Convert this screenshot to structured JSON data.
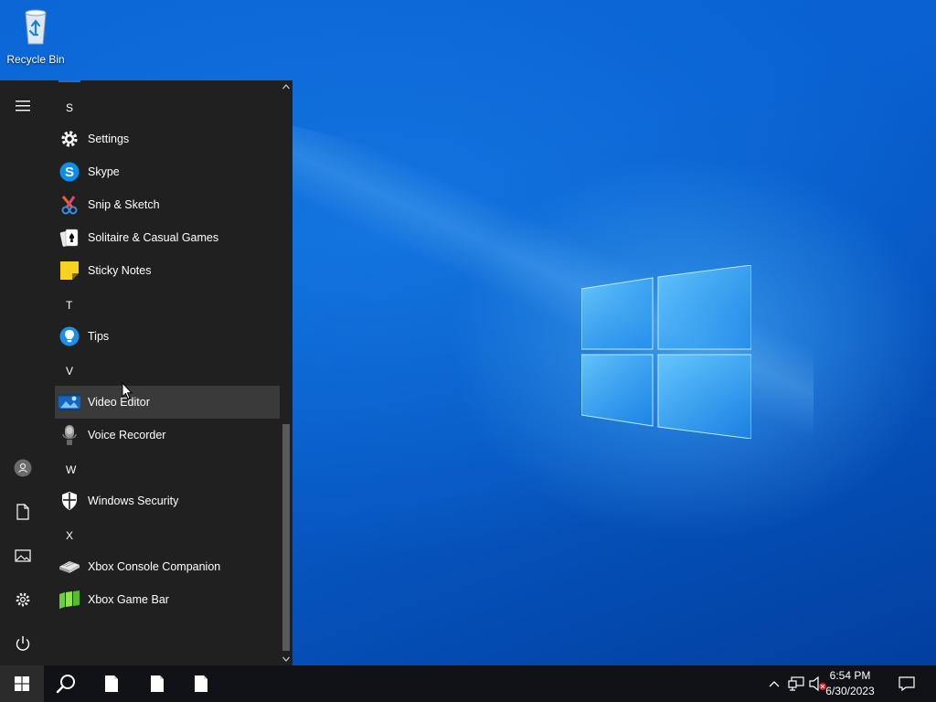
{
  "desktop": {
    "icons": [
      {
        "label": "Recycle Bin",
        "icon": "recycle-bin-icon"
      }
    ]
  },
  "start_menu": {
    "rail": {
      "items": [
        {
          "name": "hamburger-menu-icon",
          "label": ""
        },
        {
          "name": "user-account-icon",
          "label": ""
        },
        {
          "name": "documents-icon",
          "label": ""
        },
        {
          "name": "pictures-icon",
          "label": ""
        },
        {
          "name": "settings-icon",
          "label": ""
        },
        {
          "name": "power-icon",
          "label": ""
        }
      ]
    },
    "groups": [
      {
        "letter": "S",
        "apps": [
          {
            "label": "Settings",
            "icon": "gear-icon"
          },
          {
            "label": "Skype",
            "icon": "skype-icon"
          },
          {
            "label": "Snip & Sketch",
            "icon": "snip-sketch-icon"
          },
          {
            "label": "Solitaire & Casual Games",
            "icon": "solitaire-icon"
          },
          {
            "label": "Sticky Notes",
            "icon": "sticky-notes-icon"
          }
        ]
      },
      {
        "letter": "T",
        "apps": [
          {
            "label": "Tips",
            "icon": "lightbulb-icon"
          }
        ]
      },
      {
        "letter": "V",
        "apps": [
          {
            "label": "Video Editor",
            "icon": "video-editor-icon",
            "hovered": true
          },
          {
            "label": "Voice Recorder",
            "icon": "microphone-icon"
          }
        ]
      },
      {
        "letter": "W",
        "apps": [
          {
            "label": "Windows Security",
            "icon": "shield-icon"
          }
        ]
      },
      {
        "letter": "X",
        "apps": [
          {
            "label": "Xbox Console Companion",
            "icon": "xbox-console-icon"
          },
          {
            "label": "Xbox Game Bar",
            "icon": "xbox-game-bar-icon"
          }
        ]
      }
    ]
  },
  "taskbar": {
    "pinned": [
      {
        "name": "start-button",
        "icon": "windows-logo-icon"
      },
      {
        "name": "search-button",
        "icon": "search-icon"
      },
      {
        "name": "taskbar-file-1",
        "icon": "document-icon"
      },
      {
        "name": "taskbar-file-2",
        "icon": "document-icon"
      },
      {
        "name": "taskbar-file-3",
        "icon": "document-icon"
      }
    ],
    "tray": {
      "time": "6:54 PM",
      "date": "6/30/2023",
      "icons": [
        "chevron-up-icon",
        "network-icon",
        "volume-muted-icon",
        "action-center-icon"
      ]
    }
  },
  "colors": {
    "start_bg": "#202020",
    "hover_bg": "#3a3a3a",
    "taskbar_bg": "#101218",
    "accent": "#0078d7"
  }
}
